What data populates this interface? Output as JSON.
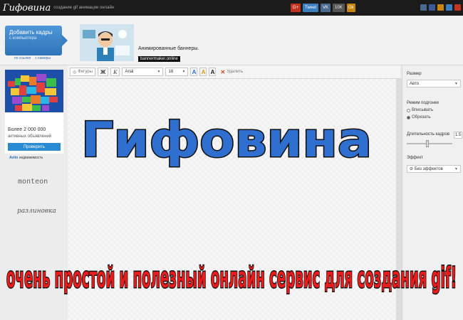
{
  "app": {
    "logo": "Гифовина",
    "tagline": "создание gif анимации онлайн"
  },
  "social": {
    "google_label": "G+",
    "twitter_label": "Tweet",
    "vk_label": "VK",
    "vk_count": "10K",
    "ok_label": "Ok"
  },
  "header": {
    "add_button_title": "Добавить кадры",
    "add_button_sub": "с компьютера",
    "link_site": "по ссылке",
    "link_camera": "с камеры",
    "banner_title": "Анимированные баннеры.",
    "banner_site": "bannermaker.online"
  },
  "ad": {
    "line1": "Более 2 000 000",
    "line2": "активных объявлений",
    "button": "Проверить",
    "brand_name": "Avito",
    "brand_sub": "недвижимость"
  },
  "left_fonts": {
    "font1": "monteon",
    "font2": "разлиновка"
  },
  "toolbar": {
    "shapes": "Фигуры",
    "bold": "Ж",
    "italic": "К",
    "font": "Arial",
    "size": "18",
    "delete": "Удалить"
  },
  "right_panel": {
    "size_label": "Размер",
    "size_value": "Авто",
    "fit_label": "Режим подгонки",
    "fit_option1": "Вписывать",
    "fit_option2": "Обрезать",
    "duration_label": "Длительность кадров",
    "duration_value": "1.5",
    "effect_label": "Эффект",
    "effect_value": "Без эффектов"
  },
  "overlay": {
    "big_title": "Гифовина",
    "slogan": "очень простой и полезный онлайн сервис для создания gif!"
  },
  "colors": {
    "title_fill": "#2f6fd0",
    "slogan_fill": "#e81c1c",
    "accent_blue": "#3a80c5"
  }
}
